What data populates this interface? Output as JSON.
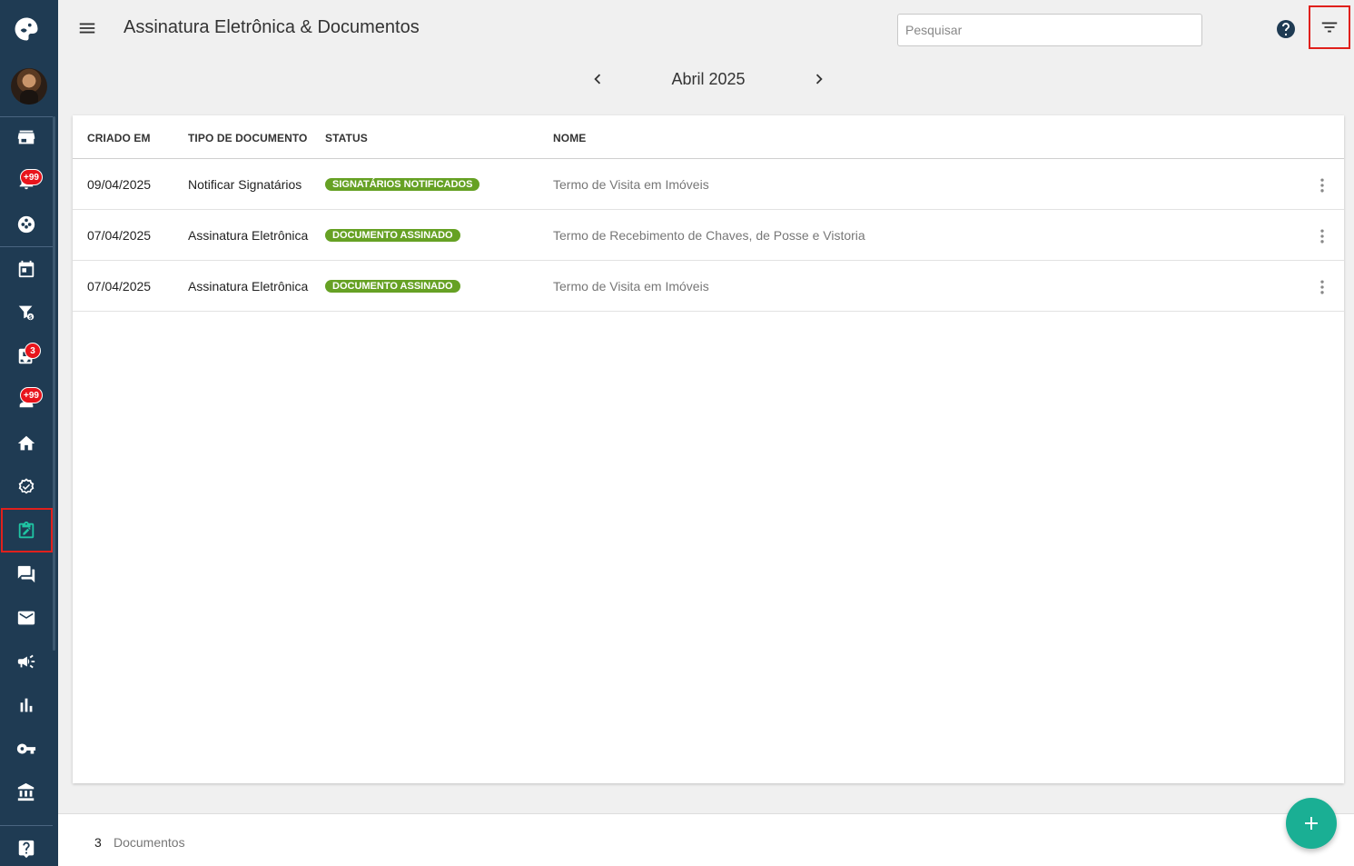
{
  "header": {
    "title": "Assinatura Eletrônica & Documentos",
    "search_placeholder": "Pesquisar",
    "menu_icon": "menu-icon",
    "help_icon": "help-icon",
    "filter_icon": "filter-icon"
  },
  "month_nav": {
    "label": "Abril 2025",
    "prev_icon": "chevron-left-icon",
    "next_icon": "chevron-right-icon"
  },
  "sidebar": {
    "items": [
      {
        "icon": "storefront-icon"
      },
      {
        "icon": "notifications-icon",
        "badge": "+99"
      },
      {
        "icon": "group-icon"
      },
      {
        "icon": "calendar-icon"
      },
      {
        "icon": "funnel-money-icon"
      },
      {
        "icon": "tasks-icon",
        "badge": "3"
      },
      {
        "icon": "contacts-icon",
        "badge": "+99"
      },
      {
        "icon": "home-icon"
      },
      {
        "icon": "verified-icon"
      },
      {
        "icon": "e-signature-icon",
        "active": true
      },
      {
        "icon": "chat-icon"
      },
      {
        "icon": "mail-icon"
      },
      {
        "icon": "campaign-icon"
      },
      {
        "icon": "bar-chart-icon"
      },
      {
        "icon": "key-icon"
      },
      {
        "icon": "bank-icon"
      },
      {
        "icon": "support-icon"
      }
    ]
  },
  "table": {
    "columns": [
      "CRIADO EM",
      "TIPO DE DOCUMENTO",
      "STATUS",
      "NOME"
    ],
    "rows": [
      {
        "created": "09/04/2025",
        "type": "Notificar Signatários",
        "status": "SIGNATÁRIOS NOTIFICADOS",
        "name": "Termo de Visita em Imóveis"
      },
      {
        "created": "07/04/2025",
        "type": "Assinatura Eletrônica",
        "status": "DOCUMENTO ASSINADO",
        "name": "Termo de Recebimento de Chaves, de Posse e Vistoria"
      },
      {
        "created": "07/04/2025",
        "type": "Assinatura Eletrônica",
        "status": "DOCUMENTO ASSINADO",
        "name": "Termo de Visita em Imóveis"
      }
    ],
    "status_color": "#66a124"
  },
  "footer": {
    "count": "3",
    "label": "Documentos"
  },
  "colors": {
    "sidebar": "#1f3b53",
    "accent": "#1aaf94",
    "highlight": "#e0201c"
  }
}
